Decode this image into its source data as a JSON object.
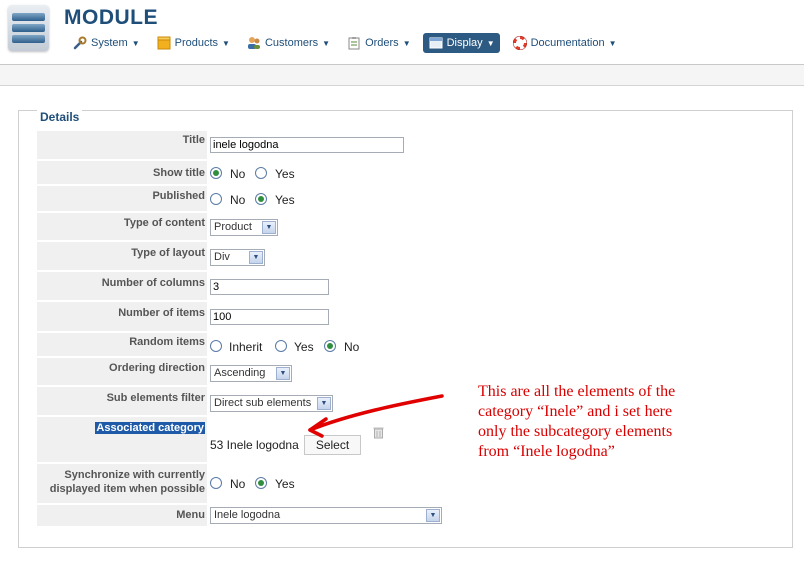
{
  "app": {
    "title": "MODULE"
  },
  "nav": {
    "items": [
      {
        "label": "System",
        "icon": "tools-icon"
      },
      {
        "label": "Products",
        "icon": "box-icon"
      },
      {
        "label": "Customers",
        "icon": "users-icon"
      },
      {
        "label": "Orders",
        "icon": "clipboard-icon"
      },
      {
        "label": "Display",
        "icon": "window-icon",
        "active": true
      },
      {
        "label": "Documentation",
        "icon": "lifebuoy-icon"
      }
    ]
  },
  "details": {
    "legend": "Details",
    "title_label": "Title",
    "title_value": "inele logodna",
    "show_title_label": "Show title",
    "show_title_options": [
      "No",
      "Yes"
    ],
    "show_title_selected": "No",
    "published_label": "Published",
    "published_options": [
      "No",
      "Yes"
    ],
    "published_selected": "Yes",
    "type_of_content_label": "Type of content",
    "type_of_content_value": "Product",
    "type_of_layout_label": "Type of layout",
    "type_of_layout_value": "Div",
    "number_of_columns_label": "Number of columns",
    "number_of_columns_value": "3",
    "number_of_items_label": "Number of items",
    "number_of_items_value": "100",
    "random_items_label": "Random items",
    "random_items_options": [
      "Inherit",
      "Yes",
      "No"
    ],
    "random_items_selected": "No",
    "ordering_direction_label": "Ordering direction",
    "ordering_direction_value": "Ascending",
    "sub_elements_filter_label": "Sub elements filter",
    "sub_elements_filter_value": "Direct sub elements",
    "associated_category_label": "Associated category",
    "associated_category_value": "53 Inele logodna",
    "select_button": "Select",
    "sync_label_line1": "Synchronize with currently",
    "sync_label_line2": "displayed item when possible",
    "sync_options": [
      "No",
      "Yes"
    ],
    "sync_selected": "Yes",
    "menu_label": "Menu",
    "menu_value": "Inele logodna"
  },
  "annotation": {
    "line1": "This are all the elements of the",
    "line2": "category “Inele” and i set here",
    "line3": "only the subcategory elements",
    "line4": "from “Inele logodna”",
    "color": "#d80000"
  },
  "colors": {
    "accent": "#1f4e79",
    "active_nav": "#2c5a82",
    "selected_label_bg": "#1e5aa8"
  }
}
